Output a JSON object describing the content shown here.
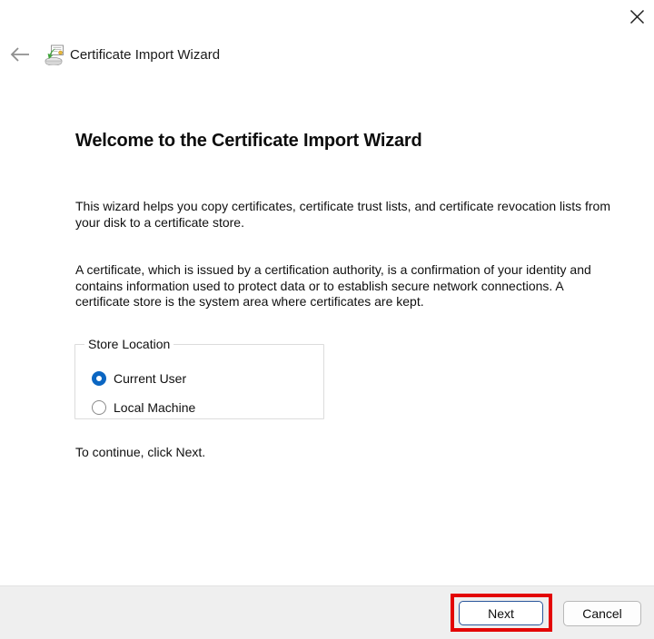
{
  "window": {
    "title": "Certificate Import Wizard"
  },
  "header": {
    "back_icon": "left-arrow",
    "app_icon": "certificate-import-icon",
    "close_icon": "close-x"
  },
  "main": {
    "heading": "Welcome to the Certificate Import Wizard",
    "paragraph1": "This wizard helps you copy certificates, certificate trust lists, and certificate revocation lists from your disk to a certificate store.",
    "paragraph2": "A certificate, which is issued by a certification authority, is a confirmation of your identity and contains information used to protect data or to establish secure network connections. A certificate store is the system area where certificates are kept.",
    "store_location": {
      "label": "Store Location",
      "options": [
        {
          "label": "Current User",
          "selected": true
        },
        {
          "label": "Local Machine",
          "selected": false
        }
      ]
    },
    "hint": "To continue, click Next."
  },
  "footer": {
    "next_label": "Next",
    "cancel_label": "Cancel"
  },
  "colors": {
    "accent_blue": "#0b66c2",
    "annotation_red": "#e30505",
    "footer_bg": "#efefef",
    "divider": "#e2e2e2"
  }
}
